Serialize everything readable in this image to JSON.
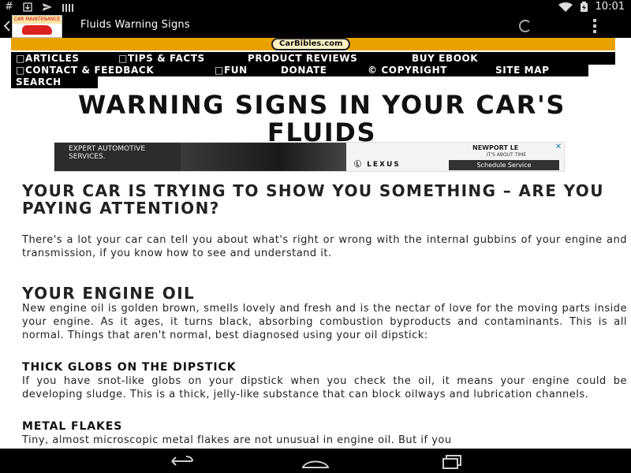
{
  "status_bar": {
    "left_icons": [
      "hash-icon",
      "download-icon",
      "send-icon",
      "signal-bars-icon"
    ],
    "clock": "10:01"
  },
  "action_bar": {
    "title": "Fluids Warning Signs",
    "app_icon_text": "CAR MAINTENANCE"
  },
  "banner": {
    "logo_text": "CarBibles.com"
  },
  "nav": {
    "items": [
      {
        "label": "□ARTICLES"
      },
      {
        "label": "□TIPS & FACTS"
      },
      {
        "label": "PRODUCT REVIEWS"
      },
      {
        "label": "BUY EBOOK"
      },
      {
        "label": "□CONTACT & FEEDBACK"
      },
      {
        "label": "□FUN"
      },
      {
        "label": "DONATE"
      },
      {
        "label": "© COPYRIGHT"
      },
      {
        "label": "SITE MAP"
      },
      {
        "label": "SEARCH"
      }
    ]
  },
  "article": {
    "title": "WARNING SIGNS IN YOUR CAR'S FLUIDS",
    "sections": [
      {
        "heading": "YOUR CAR IS TRYING TO SHOW YOU SOMETHING – ARE YOU PAYING ATTENTION?",
        "body": "There's a lot your car can tell you about what's right or wrong with the internal gubbins of your engine and transmission, if you know how to see and understand it."
      },
      {
        "heading": "YOUR ENGINE OIL",
        "body": "New engine oil is golden brown, smells lovely and fresh and is the nectar of love for the moving parts inside your engine. As it ages, it turns black, absorbing combustion byproducts and contaminants. This is all normal. Things that aren't normal, best diagnosed using your oil dipstick:"
      },
      {
        "heading": "THICK GLOBS ON THE DIPSTICK",
        "body": "If you have snot-like globs on your dipstick when you check the oil, it means your engine could be developing sludge. This is a thick, jelly-like substance that can block oilways and lubrication channels."
      },
      {
        "heading": "METAL FLAKES",
        "body": "Tiny, almost microscopic metal flakes are not unusual in engine oil. But if you"
      }
    ]
  },
  "ad": {
    "left_text": "EXPERT AUTOMOTIVE SERVICES.",
    "brand": "Ⓛ LEXUS",
    "dealer": "NEWPORT LE",
    "tagline": "IT'S ABOUT TIME",
    "button": "Schedule Service",
    "close_icon": "✕"
  },
  "system_nav": {
    "buttons": [
      "back-icon",
      "home-icon",
      "recents-icon"
    ]
  }
}
